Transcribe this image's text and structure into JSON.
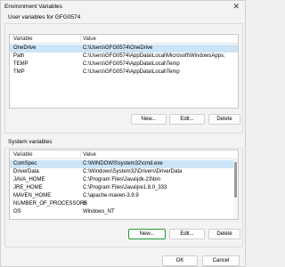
{
  "window": {
    "title": "Environment Variables"
  },
  "user_section": {
    "label": "User variables for GFG0574",
    "columns": [
      "Variable",
      "Value"
    ],
    "rows": [
      {
        "variable": "OneDrive",
        "value": "C:\\Users\\GFG0574\\OneDrive",
        "selected": true
      },
      {
        "variable": "Path",
        "value": "C:\\Users\\GFG0574\\AppData\\Local\\Microsoft\\WindowsApps;"
      },
      {
        "variable": "TEMP",
        "value": "C:\\Users\\GFG0574\\AppData\\Local\\Temp"
      },
      {
        "variable": "TMP",
        "value": "C:\\Users\\GFG0574\\AppData\\Local\\Temp"
      }
    ],
    "buttons": {
      "new": "New...",
      "edit": "Edit...",
      "delete": "Delete"
    }
  },
  "system_section": {
    "label": "System variables",
    "columns": [
      "Variable",
      "Value"
    ],
    "rows": [
      {
        "variable": "ComSpec",
        "value": "C:\\WINDOWS\\system32\\cmd.exe",
        "selected": true
      },
      {
        "variable": "DriverData",
        "value": "C:\\Windows\\System32\\Drivers\\DriverData"
      },
      {
        "variable": "JAVA_HOME",
        "value": "C:\\Program Files\\Java\\jdk-23\\bin"
      },
      {
        "variable": "JRE_HOME",
        "value": "C:\\Program Files\\Java\\jre1.8.0_333"
      },
      {
        "variable": "MAVEN_HOME",
        "value": "C:\\apache-maven-3.9.9"
      },
      {
        "variable": "NUMBER_OF_PROCESSORS",
        "value": "8"
      },
      {
        "variable": "OS",
        "value": "Windows_NT"
      }
    ],
    "buttons": {
      "new": "New...",
      "edit": "Edit...",
      "delete": "Delete"
    }
  },
  "footer": {
    "ok": "OK",
    "cancel": "Cancel"
  }
}
